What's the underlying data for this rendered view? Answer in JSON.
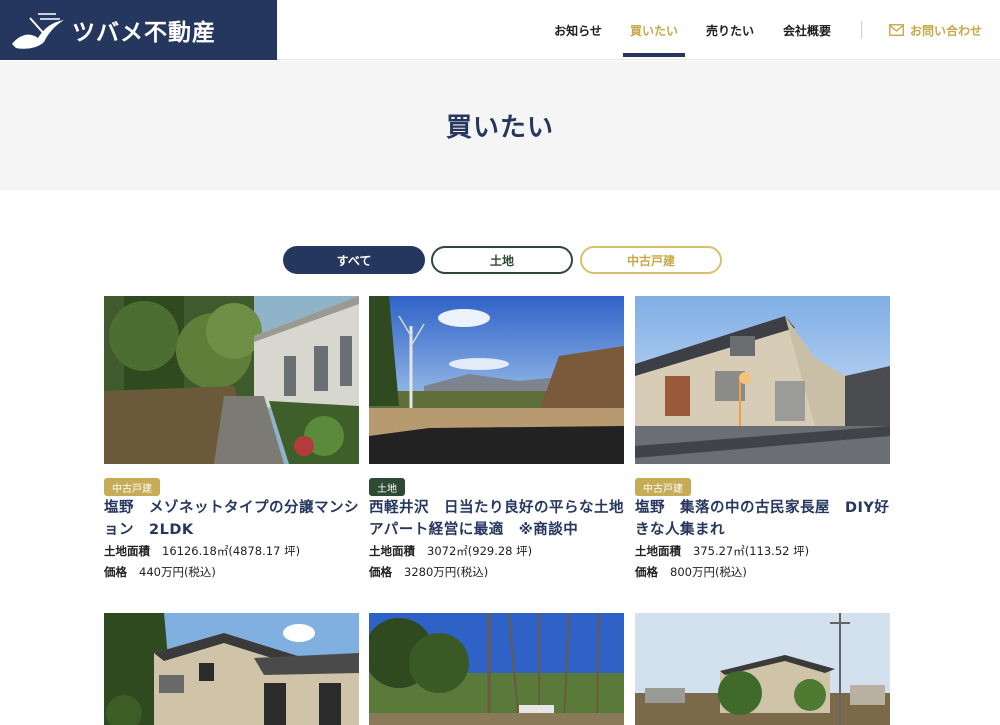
{
  "brand": {
    "name": "ツバメ不動産",
    "logo_bg": "#26375f"
  },
  "nav": {
    "items": [
      {
        "label": "お知らせ"
      },
      {
        "label": "買いたい",
        "active": true
      },
      {
        "label": "売りたい"
      },
      {
        "label": "会社概要"
      }
    ],
    "contact_label": "お問い合わせ"
  },
  "page_title": "買いたい",
  "filters": {
    "all": "すべて",
    "land": "土地",
    "used_house": "中古戸建"
  },
  "labels": {
    "land_area": "土地面積",
    "price": "価格"
  },
  "listings": [
    {
      "badge": "中古戸建",
      "title": "塩野　メゾネットタイプの分譲マンション　2LDK",
      "land_area": "16126.18㎡(4878.17 坪)",
      "price": "440万円(税込)"
    },
    {
      "badge": "土地",
      "title": "西軽井沢　日当たり良好の平らな土地　アパート経営に最適　※商談中",
      "land_area": "3072㎡(929.28 坪)",
      "price": "3280万円(税込)"
    },
    {
      "badge": "中古戸建",
      "title": "塩野　集落の中の古民家長屋　DIY好きな人集まれ",
      "land_area": "375.27㎡(113.52 坪)",
      "price": "800万円(税込)"
    }
  ],
  "colors": {
    "navy": "#26375f",
    "gold": "#c8a94a",
    "green": "#2f4a34",
    "hero_bg": "#f5f5f5"
  }
}
